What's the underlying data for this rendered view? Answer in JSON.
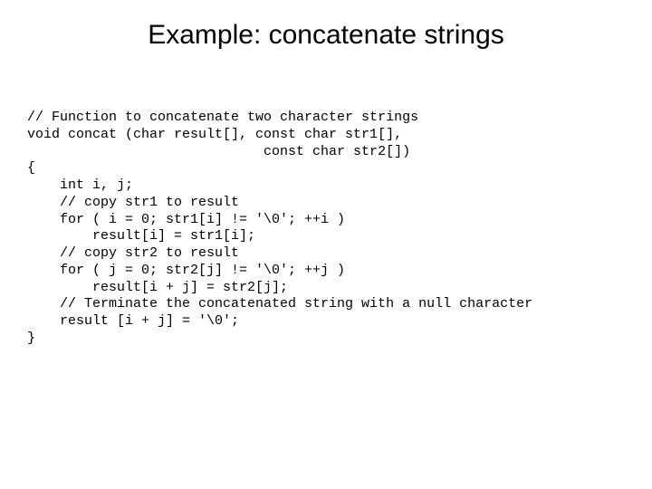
{
  "slide": {
    "title": "Example: concatenate strings",
    "code": "// Function to concatenate two character strings\nvoid concat (char result[], const char str1[],\n                             const char str2[])\n{\n    int i, j;\n    // copy str1 to result\n    for ( i = 0; str1[i] != '\\0'; ++i )\n        result[i] = str1[i];\n    // copy str2 to result\n    for ( j = 0; str2[j] != '\\0'; ++j )\n        result[i + j] = str2[j];\n    // Terminate the concatenated string with a null character\n    result [i + j] = '\\0';\n}"
  }
}
